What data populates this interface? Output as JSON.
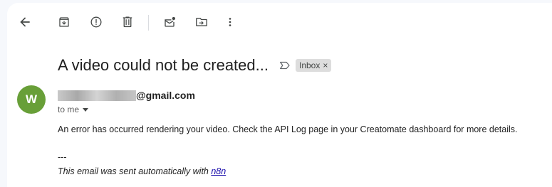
{
  "toolbar": {
    "buttons": [
      {
        "name": "back-icon"
      },
      {
        "name": "archive-icon"
      },
      {
        "name": "report-spam-icon"
      },
      {
        "name": "delete-icon"
      },
      {
        "name": "mark-unread-icon"
      },
      {
        "name": "move-to-icon"
      },
      {
        "name": "more-options-icon"
      }
    ]
  },
  "message": {
    "subject": "A video could not be created...",
    "label_icon": "label-important-icon",
    "label_chip": "Inbox",
    "label_chip_close": "×",
    "sender": {
      "avatar_letter": "W",
      "avatar_color": "#689f38",
      "email_domain": "@gmail.com"
    },
    "recipient": "to me",
    "body": "An error has occurred rendering your video. Check the API Log page in your Creatomate dashboard for more details.",
    "signature": {
      "separator": "---",
      "text": "This email was sent automatically with ",
      "link_text": "n8n"
    }
  },
  "colors": {
    "background": "#f6f8fc",
    "panel": "#ffffff",
    "link": "#1a0dab"
  }
}
